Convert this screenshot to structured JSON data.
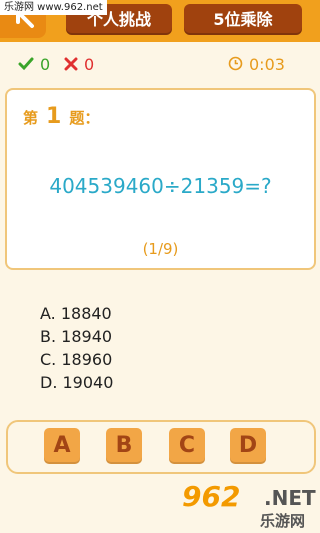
{
  "watermark": "乐游网 www.962.net",
  "header": {
    "mode_tab": "个人挑战",
    "level_tab": "5位乘除"
  },
  "stats": {
    "correct": "0",
    "wrong": "0",
    "timer": "0:03"
  },
  "question": {
    "prefix": "第",
    "number": "1",
    "suffix": "题：",
    "expression": "404539460÷21359=?",
    "progress": "(1/9)"
  },
  "options": [
    "A. 18840",
    "B. 18940",
    "C. 18960",
    "D. 19040"
  ],
  "answers": [
    "A",
    "B",
    "C",
    "D"
  ],
  "logo": {
    "brand": "962",
    "net": ".NET",
    "site": "乐游网"
  },
  "colors": {
    "header": "#f1a01d",
    "tab": "#a0420e",
    "accent": "#e79b1d",
    "correct": "#3aa52a",
    "wrong": "#e03030",
    "expression": "#2aa9c8",
    "answer_button": "#f2a646"
  }
}
